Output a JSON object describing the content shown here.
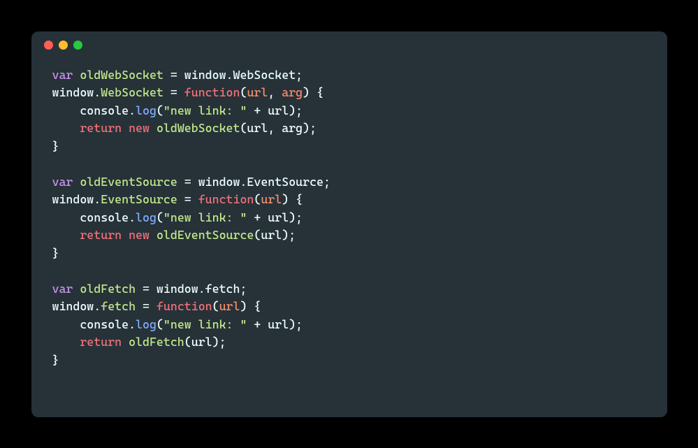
{
  "window": {
    "buttons": [
      "close",
      "minimize",
      "zoom"
    ]
  },
  "colors": {
    "background": "#263238",
    "keyword_var": "#c792ea",
    "keyword_flow": "#f07178",
    "identifier_def": "#c3e88d",
    "identifier": "#eeffff",
    "param": "#f78c6c",
    "function_call": "#82aaff",
    "string": "#c3e88d"
  },
  "code": {
    "language": "javascript",
    "tokens": [
      [
        [
          "kw",
          "var"
        ],
        [
          "id",
          " "
        ],
        [
          "def",
          "oldWebSocket"
        ],
        [
          "id",
          " = window.WebSocket;"
        ]
      ],
      [
        [
          "id",
          "window."
        ],
        [
          "def",
          "WebSocket"
        ],
        [
          "id",
          " = "
        ],
        [
          "fnkw",
          "function"
        ],
        [
          "id",
          "("
        ],
        [
          "prm",
          "url"
        ],
        [
          "id",
          ", "
        ],
        [
          "prm",
          "arg"
        ],
        [
          "id",
          ") {"
        ]
      ],
      [
        [
          "id",
          "    console."
        ],
        [
          "fn",
          "log"
        ],
        [
          "id",
          "("
        ],
        [
          "str",
          "\"new link: \""
        ],
        [
          "id",
          " + url);"
        ]
      ],
      [
        [
          "id",
          "    "
        ],
        [
          "fnkw",
          "return"
        ],
        [
          "id",
          " "
        ],
        [
          "fnkw",
          "new"
        ],
        [
          "id",
          " "
        ],
        [
          "def",
          "oldWebSocket"
        ],
        [
          "id",
          "(url, arg);"
        ]
      ],
      [
        [
          "id",
          "}"
        ]
      ],
      [],
      [
        [
          "kw",
          "var"
        ],
        [
          "id",
          " "
        ],
        [
          "def",
          "oldEventSource"
        ],
        [
          "id",
          " = window.EventSource;"
        ]
      ],
      [
        [
          "id",
          "window."
        ],
        [
          "def",
          "EventSource"
        ],
        [
          "id",
          " = "
        ],
        [
          "fnkw",
          "function"
        ],
        [
          "id",
          "("
        ],
        [
          "prm",
          "url"
        ],
        [
          "id",
          ") {"
        ]
      ],
      [
        [
          "id",
          "    console."
        ],
        [
          "fn",
          "log"
        ],
        [
          "id",
          "("
        ],
        [
          "str",
          "\"new link: \""
        ],
        [
          "id",
          " + url);"
        ]
      ],
      [
        [
          "id",
          "    "
        ],
        [
          "fnkw",
          "return"
        ],
        [
          "id",
          " "
        ],
        [
          "fnkw",
          "new"
        ],
        [
          "id",
          " "
        ],
        [
          "def",
          "oldEventSource"
        ],
        [
          "id",
          "(url);"
        ]
      ],
      [
        [
          "id",
          "}"
        ]
      ],
      [],
      [
        [
          "kw",
          "var"
        ],
        [
          "id",
          " "
        ],
        [
          "def",
          "oldFetch"
        ],
        [
          "id",
          " = window.fetch;"
        ]
      ],
      [
        [
          "id",
          "window."
        ],
        [
          "def",
          "fetch"
        ],
        [
          "id",
          " = "
        ],
        [
          "fnkw",
          "function"
        ],
        [
          "id",
          "("
        ],
        [
          "prm",
          "url"
        ],
        [
          "id",
          ") {"
        ]
      ],
      [
        [
          "id",
          "    console."
        ],
        [
          "fn",
          "log"
        ],
        [
          "id",
          "("
        ],
        [
          "str",
          "\"new link: \""
        ],
        [
          "id",
          " + url);"
        ]
      ],
      [
        [
          "id",
          "    "
        ],
        [
          "fnkw",
          "return"
        ],
        [
          "id",
          " "
        ],
        [
          "def",
          "oldFetch"
        ],
        [
          "id",
          "(url);"
        ]
      ],
      [
        [
          "id",
          "}"
        ]
      ]
    ],
    "plain": "var oldWebSocket = window.WebSocket;\nwindow.WebSocket = function(url, arg) {\n    console.log(\"new link: \" + url);\n    return new oldWebSocket(url, arg);\n}\n\nvar oldEventSource = window.EventSource;\nwindow.EventSource = function(url) {\n    console.log(\"new link: \" + url);\n    return new oldEventSource(url);\n}\n\nvar oldFetch = window.fetch;\nwindow.fetch = function(url) {\n    console.log(\"new link: \" + url);\n    return oldFetch(url);\n}"
  }
}
